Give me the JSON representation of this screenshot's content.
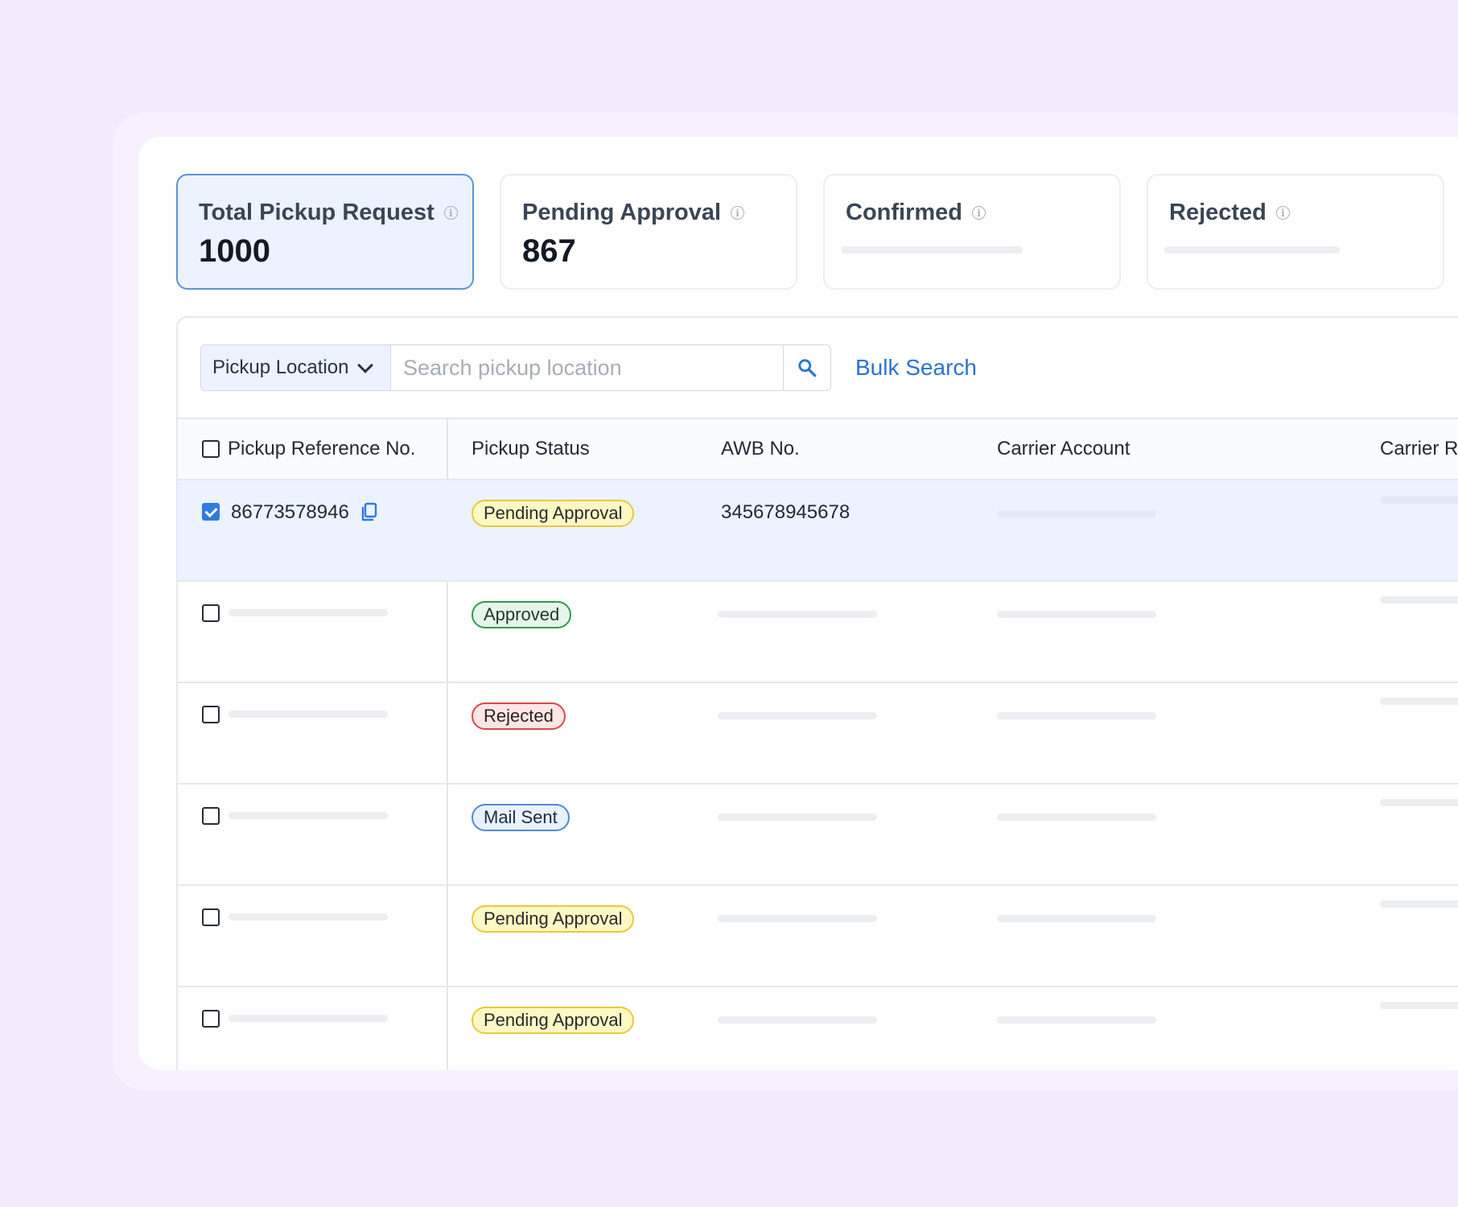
{
  "summary_cards": [
    {
      "title": "Total Pickup Request",
      "value": "1000",
      "active": true
    },
    {
      "title": "Pending Approval",
      "value": "867",
      "active": false
    },
    {
      "title": "Confirmed",
      "value": "",
      "active": false
    },
    {
      "title": "Rejected",
      "value": "",
      "active": false
    }
  ],
  "info_glyph": "i",
  "filter": {
    "dropdown_label": "Pickup Location",
    "search_placeholder": "Search pickup location",
    "search_value": "",
    "bulk_search_label": "Bulk Search"
  },
  "table": {
    "columns": [
      "Pickup Reference No.",
      "Pickup Status",
      "AWB No.",
      "Carrier Account",
      "Carrier R"
    ],
    "rows": [
      {
        "ref": "86773578946",
        "status": "Pending Approval",
        "awb": "345678945678",
        "checked": true
      },
      {
        "ref": "",
        "status": "Approved",
        "awb": "",
        "checked": false
      },
      {
        "ref": "",
        "status": "Rejected",
        "awb": "",
        "checked": false
      },
      {
        "ref": "",
        "status": "Mail Sent",
        "awb": "",
        "checked": false
      },
      {
        "ref": "",
        "status": "Pending Approval",
        "awb": "",
        "checked": false
      },
      {
        "ref": "",
        "status": "Pending Approval",
        "awb": "",
        "checked": false
      }
    ]
  },
  "status_colors": {
    "Pending Approval": {
      "bg": "#fff8c5",
      "border": "#e8c93a",
      "text": "#2a2a2a"
    },
    "Approved": {
      "bg": "#e6f6ea",
      "border": "#2f9a52",
      "text": "#1f3b27"
    },
    "Rejected": {
      "bg": "#fde6e6",
      "border": "#d94848",
      "text": "#2f2020"
    },
    "Mail Sent": {
      "bg": "#e9f1fd",
      "border": "#4f8ad6",
      "text": "#1d2d44"
    }
  },
  "colors": {
    "accent": "#2b73d2",
    "page_bg": "#f4eafe",
    "selected_row_bg": "#ecf3ff"
  },
  "icons": [
    "info-icon",
    "chevron-down-icon",
    "search-icon",
    "copy-icon",
    "checkbox-icon"
  ]
}
